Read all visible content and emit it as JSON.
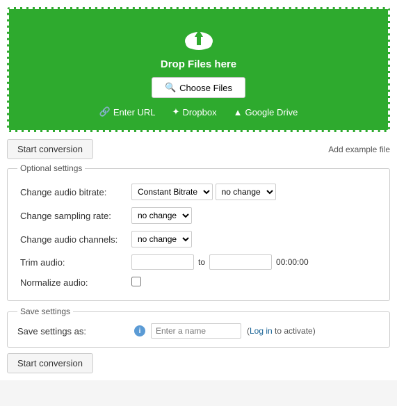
{
  "dropzone": {
    "drop_text": "Drop Files here",
    "choose_files_label": "Choose Files",
    "enter_url_label": "Enter URL",
    "dropbox_label": "Dropbox",
    "google_drive_label": "Google Drive"
  },
  "toolbar": {
    "start_conversion_label": "Start conversion",
    "add_example_label": "Add example file"
  },
  "optional_settings": {
    "legend": "Optional settings",
    "bitrate_label": "Change audio bitrate:",
    "bitrate_option1": "Constant Bitrate",
    "bitrate_option2": "no change",
    "sampling_label": "Change sampling rate:",
    "sampling_option": "no change",
    "channels_label": "Change audio channels:",
    "channels_option": "no change",
    "trim_label": "Trim audio:",
    "trim_to": "to",
    "trim_time": "00:00:00",
    "normalize_label": "Normalize audio:"
  },
  "save_settings": {
    "legend": "Save settings",
    "save_label": "Save settings as:",
    "name_placeholder": "Enter a name",
    "login_text": "(Log in to activate)"
  },
  "bottom_toolbar": {
    "start_conversion_label": "Start conversion"
  },
  "icons": {
    "link_glyph": "🔗",
    "dropbox_glyph": "✦",
    "drive_glyph": "▲",
    "search_glyph": "🔍",
    "info_glyph": "i"
  }
}
